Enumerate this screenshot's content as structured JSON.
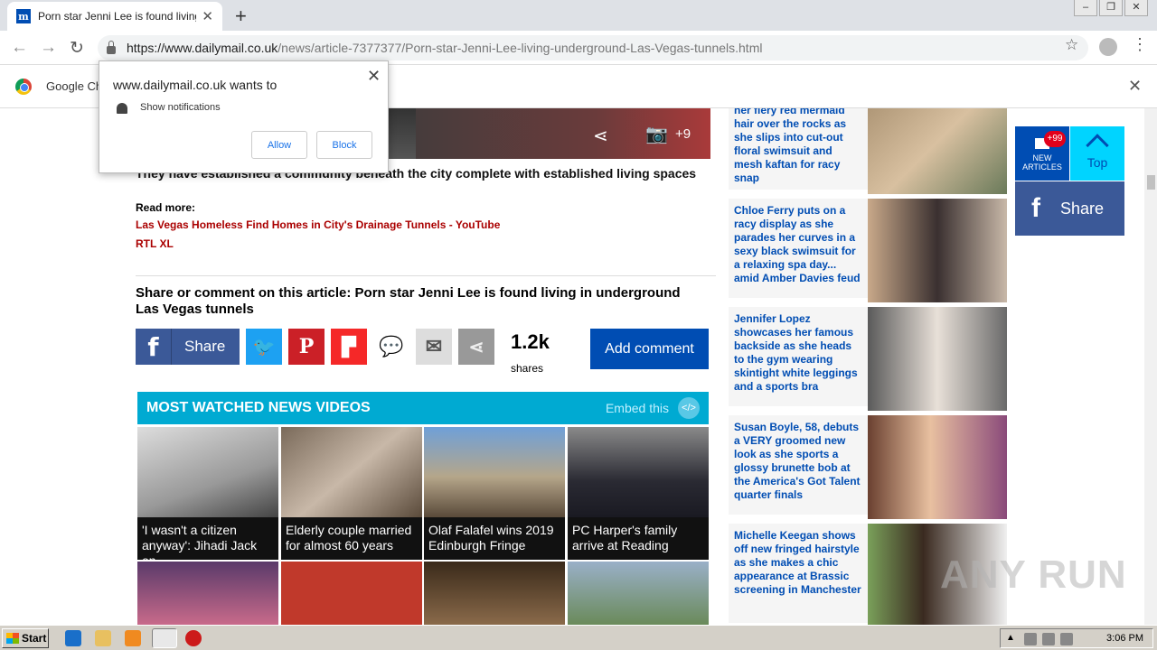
{
  "browser": {
    "tab_title": "Porn star Jenni Lee is found living in",
    "tab_favicon": "m",
    "url_host": "https://www.dailymail.co.uk",
    "url_path": "/news/article-7377377/Porn-star-Jenni-Lee-living-underground-Las-Vegas-tunnels.html",
    "infobar_text": "Google Ch"
  },
  "notification": {
    "title": "www.dailymail.co.uk wants to",
    "text": "Show notifications",
    "allow": "Allow",
    "block": "Block"
  },
  "article": {
    "photo_count": "+9",
    "caption": "They have established a community beneath the city complete with established living spaces",
    "read_more": "Read more:",
    "links": [
      "Las Vegas Homeless Find Homes in City's Drainage Tunnels - YouTube",
      "RTL XL"
    ],
    "share_heading": "Share or comment on this article: Porn star Jenni Lee is found living in underground Las Vegas tunnels",
    "share_label": "Share",
    "share_count": "1.2k",
    "shares_label": "shares",
    "add_comment": "Add comment"
  },
  "videos": {
    "heading": "MOST WATCHED NEWS VIDEOS",
    "embed": "Embed this",
    "items": [
      {
        "caption": "'I wasn't a citizen anyway': Jihadi Jack on"
      },
      {
        "caption": "Elderly couple married for almost 60 years"
      },
      {
        "caption": "Olaf Falafel wins 2019 Edinburgh Fringe"
      },
      {
        "caption": "PC Harper's family arrive at Reading"
      }
    ]
  },
  "sidebar": {
    "items": [
      {
        "text": "Lindsey Bolton lift spot her fiery red mermaid hair over the rocks as she slips into cut-out floral swimsuit and mesh kaftan for racy snap"
      },
      {
        "text": "Chloe Ferry puts on a racy display as she parades her curves in a sexy black swimsuit for a relaxing spa day... amid Amber Davies feud"
      },
      {
        "text": "Jennifer Lopez showcases her famous backside as she heads to the gym wearing skintight white leggings and a sports bra"
      },
      {
        "text": "Susan Boyle, 58, debuts a VERY groomed new look as she sports a glossy brunette bob at the America's Got Talent quarter finals"
      },
      {
        "text": "Michelle Keegan shows off new fringed hairstyle as she makes a chic appearance at Brassic screening in Manchester"
      }
    ]
  },
  "widget": {
    "badge": "+99",
    "new_articles": "NEW ARTICLES",
    "top": "Top",
    "share": "Share"
  },
  "watermark": "ANY RUN",
  "taskbar": {
    "start": "Start",
    "time": "3:06 PM"
  }
}
